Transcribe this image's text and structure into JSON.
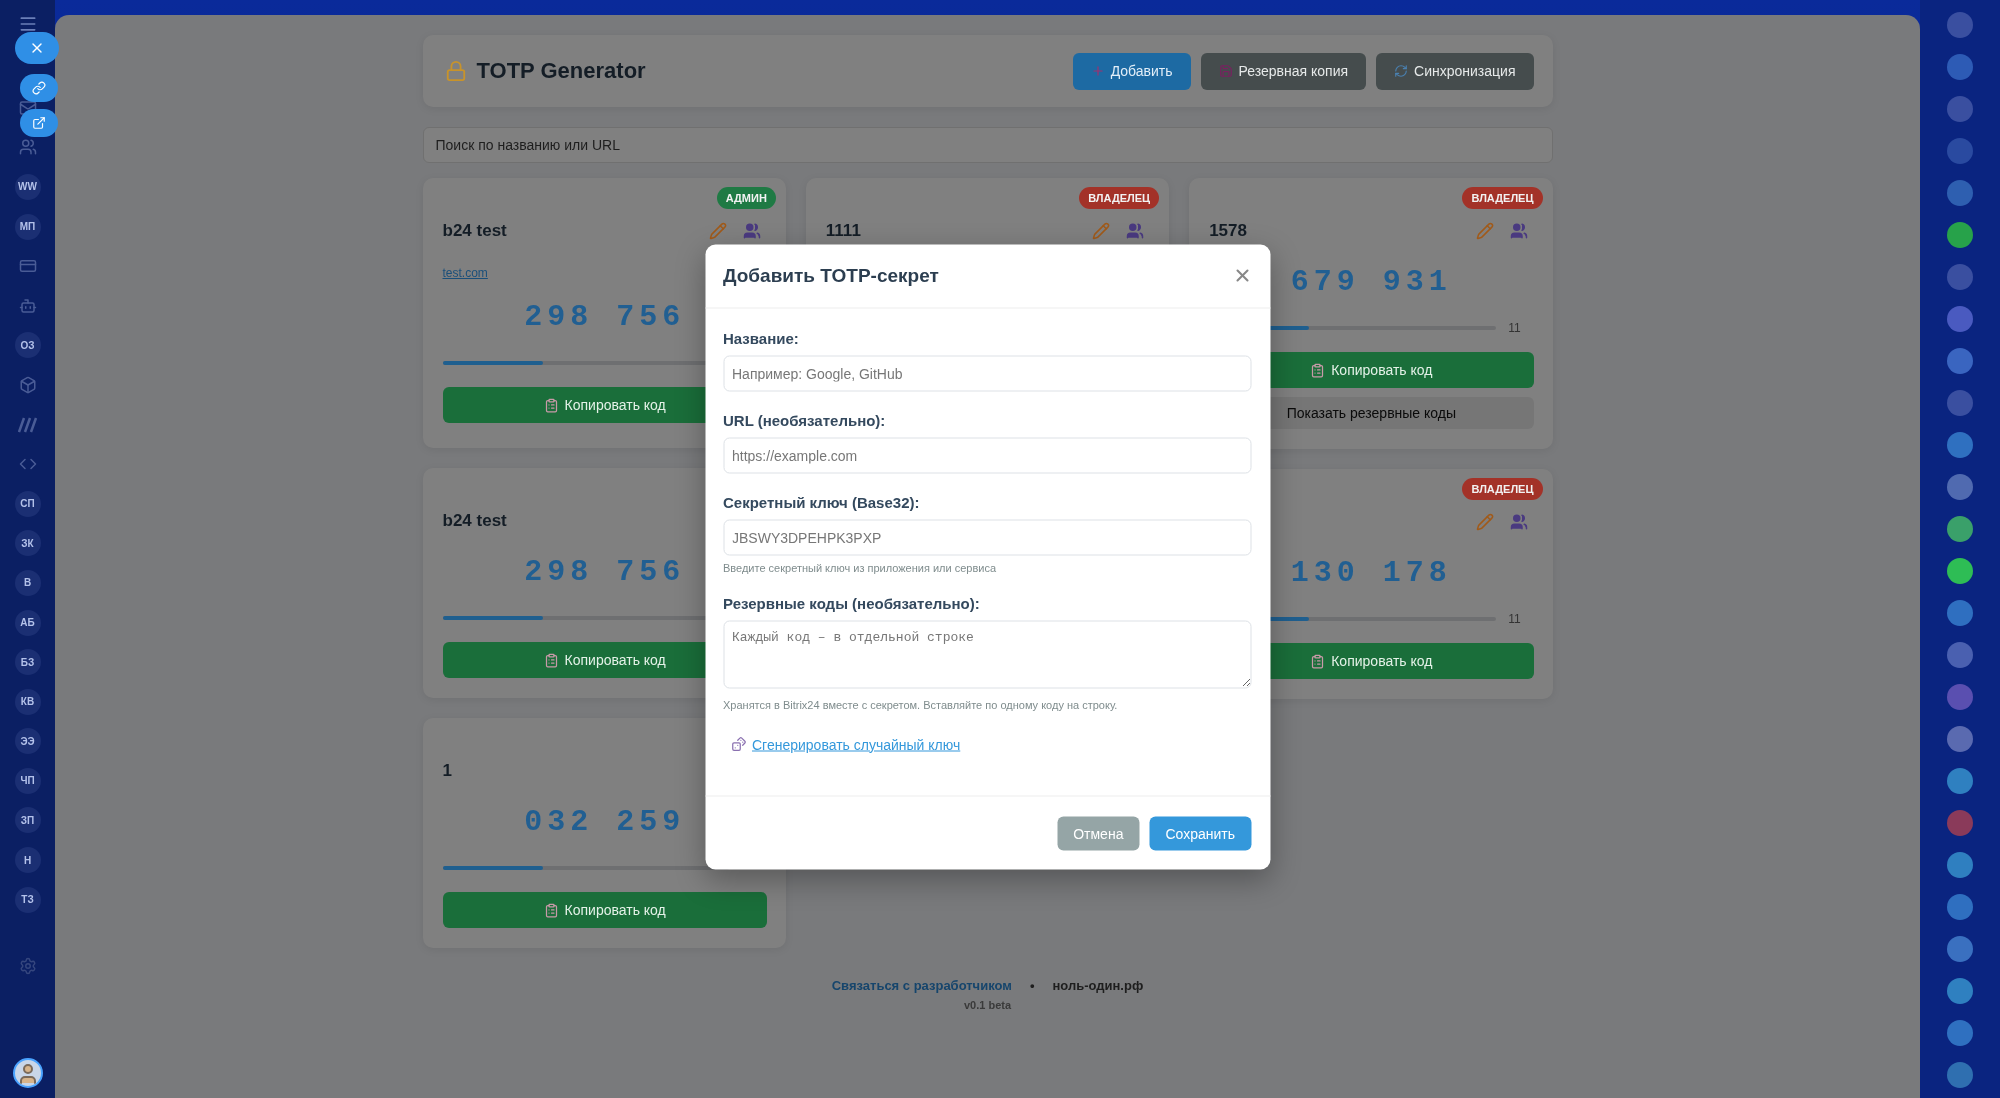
{
  "sidebar": {
    "items": [
      {
        "kind": "mail"
      },
      {
        "kind": "people"
      },
      {
        "kind": "initials",
        "text": "WW"
      },
      {
        "kind": "initials",
        "text": "МП"
      },
      {
        "kind": "card"
      },
      {
        "kind": "robot"
      },
      {
        "kind": "initials",
        "text": "ОЗ"
      },
      {
        "kind": "box"
      },
      {
        "kind": "brand"
      },
      {
        "kind": "code"
      },
      {
        "kind": "initials",
        "text": "СП"
      },
      {
        "kind": "initials",
        "text": "ЗК"
      },
      {
        "kind": "initials",
        "text": "В"
      },
      {
        "kind": "initials",
        "text": "АБ"
      },
      {
        "kind": "initials",
        "text": "БЗ"
      },
      {
        "kind": "initials",
        "text": "КВ"
      },
      {
        "kind": "initials",
        "text": "ЭЭ"
      },
      {
        "kind": "initials",
        "text": "ЧП"
      },
      {
        "kind": "initials",
        "text": "ЗП"
      },
      {
        "kind": "initials",
        "text": "Н"
      },
      {
        "kind": "initials",
        "text": "ТЗ"
      }
    ]
  },
  "header": {
    "title": "TOTP Generator",
    "buttons": [
      {
        "label": "Добавить",
        "kind": "primary"
      },
      {
        "label": "Резервная копия",
        "kind": "secondary"
      },
      {
        "label": "Синхронизация",
        "kind": "secondary"
      }
    ]
  },
  "search": {
    "placeholder": "Поиск по названию или URL"
  },
  "columns": [
    {
      "cards": [
        {
          "title": "b24 test",
          "badge": {
            "label": "АДМИН",
            "color": "#1f7a44"
          },
          "url": "test.com",
          "code": "298 756",
          "level": 0.35,
          "copy_label": "Копировать код"
        },
        {
          "title": "b24 test",
          "code": "298 756",
          "level": 0.35,
          "copy_label": "Копировать код"
        },
        {
          "title": "1",
          "code": "032 259",
          "level": 0.35,
          "copy_label": "Копировать код"
        }
      ]
    },
    {
      "cards": [
        {
          "title": "1111",
          "badge": {
            "label": "ВЛАДЕЛЕЦ",
            "color": "#a33228"
          }
        }
      ]
    },
    {
      "cards": [
        {
          "title": "1578",
          "badge": {
            "label": "ВЛАДЕЛЕЦ",
            "color": "#a33228"
          },
          "code": "679 931",
          "level": 0.35,
          "timer": "11",
          "copy_label": "Копировать код",
          "backup_label": "Показать резервные коды"
        },
        {
          "badge": {
            "label": "ВЛАДЕЛЕЦ",
            "color": "#a33228"
          },
          "code": "130 178",
          "level": 0.35,
          "timer": "11",
          "copy_label": "Копировать код"
        }
      ]
    }
  ],
  "footer": {
    "contact": "Связаться с разработчиком",
    "separator": "•",
    "site": "ноль-один.рф",
    "version": "v0.1 beta"
  },
  "modal": {
    "title": "Добавить TOTP-секрет",
    "fields": [
      {
        "kind": "input",
        "label": "Название:",
        "placeholder": "Например: Google, GitHub"
      },
      {
        "kind": "input",
        "label": "URL (необязательно):",
        "placeholder": "https://example.com"
      },
      {
        "kind": "input",
        "label": "Секретный ключ (Base32):",
        "placeholder": "JBSWY3DPEHPK3PXP",
        "hint": "Введите секретный ключ из приложения или сервиса"
      },
      {
        "kind": "textarea",
        "label": "Резервные коды (необязательно):",
        "placeholder": "Каждый код – в отдельной строке",
        "hint": "Хранятся в Bitrix24 вместе с секретом. Вставляйте по одному коду на строку."
      }
    ],
    "generate_link": "Сгенерировать случайный ключ",
    "buttons": [
      {
        "label": "Отмена",
        "kind": "secondary"
      },
      {
        "label": "Сохранить",
        "kind": "primary"
      }
    ]
  }
}
